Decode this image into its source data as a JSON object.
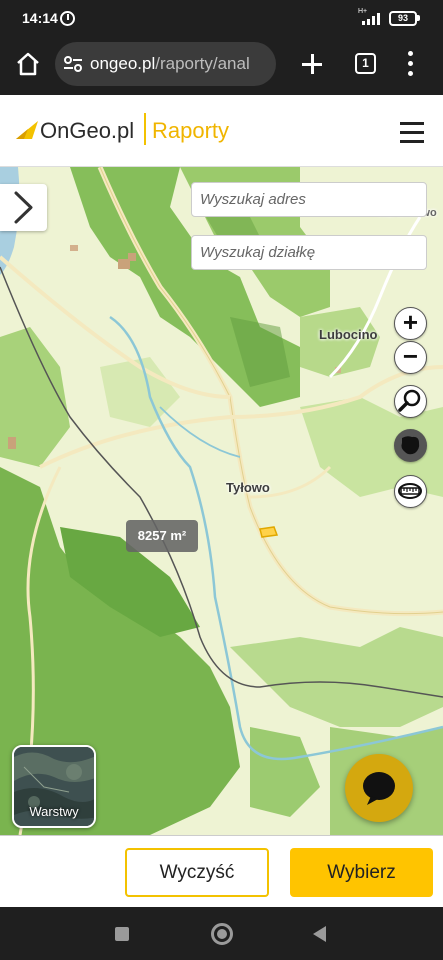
{
  "status_bar": {
    "time": "14:14",
    "network": "H+",
    "battery": "93"
  },
  "browser": {
    "url_domain": "ongeo.pl",
    "url_path": "/raporty/anal",
    "tab_count": "1"
  },
  "header": {
    "logo_text": "OnGeo.pl",
    "section": "Raporty"
  },
  "map": {
    "search_address_placeholder": "Wyszukaj adres",
    "search_parcel_placeholder": "Wyszukaj działkę",
    "zoom_in": "+",
    "zoom_out": "−",
    "area_label": "8257 m²",
    "layers_label": "Warstwy",
    "places": {
      "lubocino": "Lubocino",
      "tylowo": "Tyłowo",
      "top_right": "Karwinowo"
    },
    "tools": [
      "zoom-in",
      "zoom-out",
      "search-icon",
      "parcel-shape-icon",
      "measure-tape-icon"
    ]
  },
  "actions": {
    "clear_label": "Wyczyść",
    "select_label": "Wybierz"
  },
  "colors": {
    "brand_yellow": "#ffc400",
    "forest_green": "#78b44e",
    "meadow": "#eef3d3"
  }
}
